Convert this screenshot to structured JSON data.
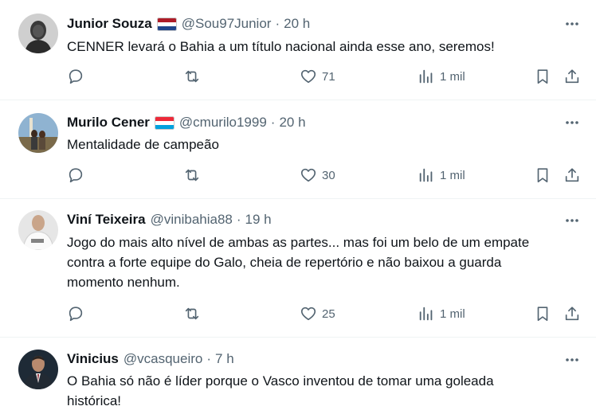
{
  "tweets": [
    {
      "name": "Junior Souza",
      "handle": "@Sou97Junior",
      "time": "20 h",
      "lines": [
        "CENNER levará o Bahia a um título nacional ainda esse ano, seremos!"
      ],
      "likes": "71",
      "views": "1 mil",
      "flag": "netherlands-flag",
      "avatar": "dark-portrait-avatar"
    },
    {
      "name": "Murilo Cener",
      "handle": "@cmurilo1999",
      "time": "20 h",
      "lines": [
        "Mentalidade de campeão"
      ],
      "likes": "30",
      "views": "1 mil",
      "flag": "luxembourg-flag",
      "avatar": "outdoor-couple-avatar"
    },
    {
      "name": "Viní Teixeira",
      "handle": "@vinibahia88",
      "time": "19 h",
      "lines": [
        "Jogo do mais alto nível de ambas as partes... mas foi um belo de um empate",
        "contra a forte equipe do Galo, cheia de repertório e não baixou a guarda",
        "momento nenhum."
      ],
      "likes": "25",
      "views": "1 mil",
      "avatar": "white-shirt-avatar"
    },
    {
      "name": "Vinicius",
      "handle": "@vcasqueiro",
      "time": "7 h",
      "lines": [
        "O Bahia só não é líder porque o Vasco inventou de tomar uma goleada",
        "histórica!"
      ],
      "avatar": "suit-portrait-avatar"
    }
  ],
  "separator": "·",
  "colors": {
    "text": "#0f1419",
    "secondary": "#536471",
    "divider": "#eff3f4"
  }
}
